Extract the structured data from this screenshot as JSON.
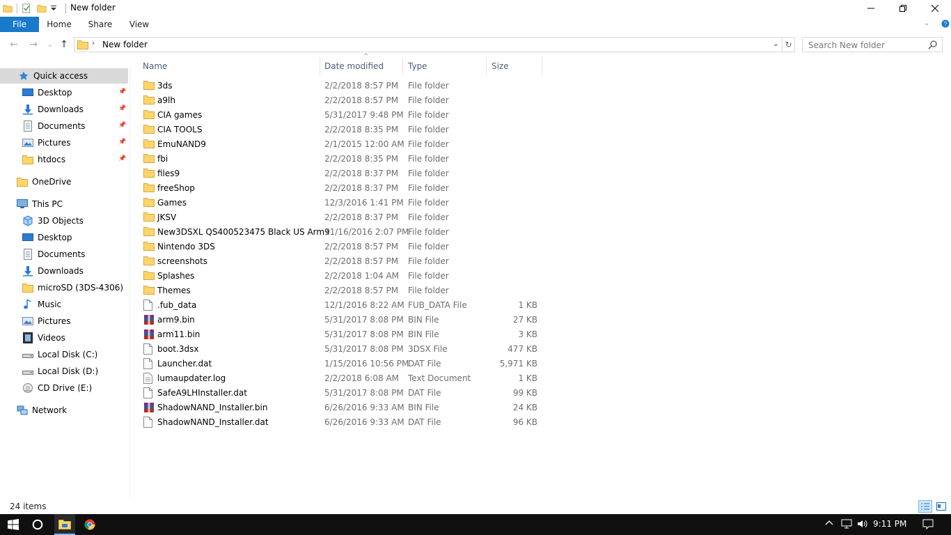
{
  "window": {
    "title": "New folder",
    "controls": {
      "minimize": "—",
      "maximize": "❐",
      "close": "✕"
    }
  },
  "ribbon": {
    "tabs": [
      "File",
      "Home",
      "Share",
      "View"
    ],
    "expand_glyph": "⌄",
    "help_glyph": "?"
  },
  "address": {
    "path": "New folder",
    "separator": "›",
    "dropdown_glyph": "⌄",
    "refresh_glyph": "↻"
  },
  "search": {
    "placeholder": "Search New folder"
  },
  "nav": {
    "back_glyph": "←",
    "forward_glyph": "→",
    "recent_glyph": "⌄",
    "up_glyph": "↑"
  },
  "sidebar": {
    "quick_access": "Quick access",
    "quick_items": [
      {
        "label": "Desktop",
        "icon": "desktop-icon"
      },
      {
        "label": "Downloads",
        "icon": "downloads-icon"
      },
      {
        "label": "Documents",
        "icon": "documents-icon"
      },
      {
        "label": "Pictures",
        "icon": "pictures-icon"
      },
      {
        "label": "htdocs",
        "icon": "folder-icon"
      }
    ],
    "onedrive": "OneDrive",
    "this_pc": "This PC",
    "pc_items": [
      {
        "label": "3D Objects",
        "icon": "3d-objects-icon"
      },
      {
        "label": "Desktop",
        "icon": "desktop-icon"
      },
      {
        "label": "Documents",
        "icon": "documents-icon"
      },
      {
        "label": "Downloads",
        "icon": "downloads-icon"
      },
      {
        "label": "microSD (3DS-4306)",
        "icon": "folder-icon"
      },
      {
        "label": "Music",
        "icon": "music-icon"
      },
      {
        "label": "Pictures",
        "icon": "pictures-icon"
      },
      {
        "label": "Videos",
        "icon": "videos-icon"
      },
      {
        "label": "Local Disk (C:)",
        "icon": "drive-icon"
      },
      {
        "label": "Local Disk (D:)",
        "icon": "drive-icon"
      },
      {
        "label": "CD Drive (E:)",
        "icon": "cd-drive-icon"
      }
    ],
    "network": "Network",
    "pin_glyph": "📌"
  },
  "columns": {
    "name": "Name",
    "date": "Date modified",
    "type": "Type",
    "size": "Size",
    "sort_glyph": "^"
  },
  "files": [
    {
      "name": "3ds",
      "date": "2/2/2018 8:57 PM",
      "type": "File folder",
      "size": "",
      "icon": "folder"
    },
    {
      "name": "a9lh",
      "date": "2/2/2018 8:57 PM",
      "type": "File folder",
      "size": "",
      "icon": "folder"
    },
    {
      "name": "CIA games",
      "date": "5/31/2017 9:48 PM",
      "type": "File folder",
      "size": "",
      "icon": "folder"
    },
    {
      "name": "CIA TOOLS",
      "date": "2/2/2018 8:35 PM",
      "type": "File folder",
      "size": "",
      "icon": "folder"
    },
    {
      "name": "EmuNAND9",
      "date": "2/1/2015 12:00 AM",
      "type": "File folder",
      "size": "",
      "icon": "folder"
    },
    {
      "name": "fbi",
      "date": "2/2/2018 8:35 PM",
      "type": "File folder",
      "size": "",
      "icon": "folder"
    },
    {
      "name": "files9",
      "date": "2/2/2018 8:37 PM",
      "type": "File folder",
      "size": "",
      "icon": "folder"
    },
    {
      "name": "freeShop",
      "date": "2/2/2018 8:37 PM",
      "type": "File folder",
      "size": "",
      "icon": "folder"
    },
    {
      "name": "Games",
      "date": "12/3/2016 1:41 PM",
      "type": "File folder",
      "size": "",
      "icon": "folder"
    },
    {
      "name": "JKSV",
      "date": "2/2/2018 8:37 PM",
      "type": "File folder",
      "size": "",
      "icon": "folder"
    },
    {
      "name": "New3DSXL QS400523475 Black US Arm9",
      "date": "11/16/2016 2:07 PM",
      "type": "File folder",
      "size": "",
      "icon": "folder"
    },
    {
      "name": "Nintendo 3DS",
      "date": "2/2/2018 8:57 PM",
      "type": "File folder",
      "size": "",
      "icon": "folder"
    },
    {
      "name": "screenshots",
      "date": "2/2/2018 8:57 PM",
      "type": "File folder",
      "size": "",
      "icon": "folder"
    },
    {
      "name": "Splashes",
      "date": "2/2/2018 1:04 AM",
      "type": "File folder",
      "size": "",
      "icon": "folder"
    },
    {
      "name": "Themes",
      "date": "2/2/2018 8:57 PM",
      "type": "File folder",
      "size": "",
      "icon": "folder"
    },
    {
      "name": ".fub_data",
      "date": "12/1/2016 8:22 AM",
      "type": "FUB_DATA File",
      "size": "1 KB",
      "icon": "file"
    },
    {
      "name": "arm9.bin",
      "date": "5/31/2017 8:08 PM",
      "type": "BIN File",
      "size": "27 KB",
      "icon": "archive"
    },
    {
      "name": "arm11.bin",
      "date": "5/31/2017 8:08 PM",
      "type": "BIN File",
      "size": "3 KB",
      "icon": "archive"
    },
    {
      "name": "boot.3dsx",
      "date": "5/31/2017 8:08 PM",
      "type": "3DSX File",
      "size": "477 KB",
      "icon": "file"
    },
    {
      "name": "Launcher.dat",
      "date": "1/15/2016 10:56 PM",
      "type": "DAT File",
      "size": "5,971 KB",
      "icon": "file"
    },
    {
      "name": "lumaupdater.log",
      "date": "2/2/2018 6:08 AM",
      "type": "Text Document",
      "size": "1 KB",
      "icon": "text"
    },
    {
      "name": "SafeA9LHInstaller.dat",
      "date": "5/31/2017 8:08 PM",
      "type": "DAT File",
      "size": "99 KB",
      "icon": "file"
    },
    {
      "name": "ShadowNAND_Installer.bin",
      "date": "6/26/2016 9:33 AM",
      "type": "BIN File",
      "size": "24 KB",
      "icon": "archive"
    },
    {
      "name": "ShadowNAND_Installer.dat",
      "date": "6/26/2016 9:33 AM",
      "type": "DAT File",
      "size": "96 KB",
      "icon": "file"
    }
  ],
  "status": {
    "item_count": "24 items"
  },
  "taskbar": {
    "clock": "9:11 PM"
  },
  "colors": {
    "accent": "#1979ca",
    "folder": "#ffd56a",
    "selection": "#d9d9d9",
    "header_text": "#4c607a"
  }
}
